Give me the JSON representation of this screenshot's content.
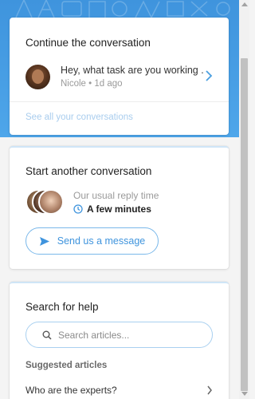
{
  "colors": {
    "header_blue": "#3f94dd",
    "accent_blue": "#3f94dd",
    "link_faint_blue": "#a9cdee",
    "card_bg": "#ffffff",
    "page_bg": "#f4f4f4"
  },
  "continue_card": {
    "title": "Continue the conversation",
    "conversation": {
      "message": "Hey, what task are you working ...",
      "author": "Nicole",
      "separator": "•",
      "time": "1d ago",
      "avatar_icon": "avatar-photo",
      "chevron_icon": "chevron-right-icon"
    },
    "see_all_link": "See all your conversations"
  },
  "start_card": {
    "title": "Start another conversation",
    "reply_label": "Our usual reply time",
    "reply_time": "A few minutes",
    "clock_icon": "clock-icon",
    "send_button": "Send us a message",
    "send_icon": "paper-plane-icon"
  },
  "search_card": {
    "title": "Search for help",
    "search": {
      "placeholder": "Search articles...",
      "value": "",
      "icon": "search-icon"
    },
    "suggested_label": "Suggested articles",
    "articles": [
      {
        "title": "Who are the experts?"
      }
    ]
  }
}
